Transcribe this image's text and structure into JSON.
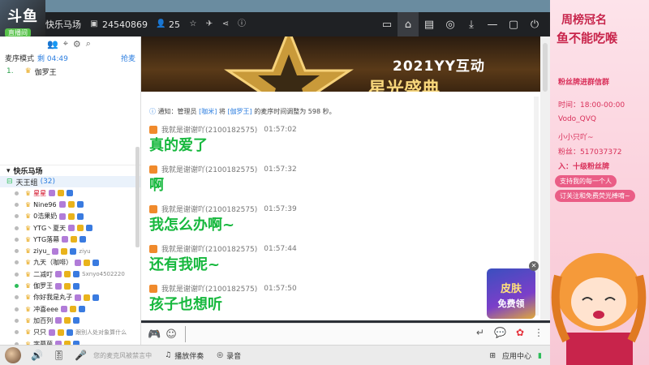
{
  "window": {
    "channel_name": "快乐马场",
    "channel_id": "24540869",
    "user_count": "25",
    "logo_text": "斗鱼",
    "level_badge": "直播间"
  },
  "queue": {
    "mode_label": "麦序模式",
    "remaining_label": "剩 04:49",
    "grab_label": "抢麦",
    "items": [
      {
        "num": "1.",
        "name": "伽罗王"
      }
    ]
  },
  "members": {
    "channel": "快乐马场",
    "group_name": "天王组",
    "group_count": "(32)",
    "list": [
      {
        "name": "星星",
        "online": false,
        "red": true
      },
      {
        "name": "Nine96",
        "online": false
      },
      {
        "name": "0浩果奶",
        "online": false
      },
      {
        "name": "YTG丶夏天",
        "online": false
      },
      {
        "name": "YTG落幕",
        "online": false
      },
      {
        "name": "ziyu_",
        "online": false,
        "tag": "ziyu"
      },
      {
        "name": "九天（咖啡）",
        "online": false
      },
      {
        "name": "二减叮",
        "online": false,
        "tag": "Sxnyo4502220"
      },
      {
        "name": "伽罗王",
        "online": true
      },
      {
        "name": "你好我是丸子",
        "online": false
      },
      {
        "name": "冲喜eee",
        "online": false
      },
      {
        "name": "加百列",
        "online": false
      },
      {
        "name": "只只",
        "online": false,
        "tag": "跟别人处对象算什么"
      },
      {
        "name": "字幕菌",
        "online": false
      },
      {
        "name": "小乐爱片",
        "online": false,
        "tag": "我好饱"
      }
    ]
  },
  "banner": {
    "title": "2021YY互动",
    "subtitle": "星光盛典"
  },
  "chat": {
    "notice_prefix": "通知：管理员",
    "notice_admin": "[咖米]",
    "notice_mid": "将",
    "notice_target": "[伽罗王]",
    "notice_suffix": "的麦序时间调整为 598 秒。",
    "messages": [
      {
        "user": "我就是谢谢吖(2100182575)",
        "time": "01:57:02",
        "text": "真的爱了"
      },
      {
        "user": "我就是谢谢吖(2100182575)",
        "time": "01:57:32",
        "text": "啊"
      },
      {
        "user": "我就是谢谢吖(2100182575)",
        "time": "01:57:39",
        "text": "我怎么办啊~"
      },
      {
        "user": "我就是谢谢吖(2100182575)",
        "time": "01:57:44",
        "text": "还有我呢~"
      },
      {
        "user": "我就是谢谢吖(2100182575)",
        "time": "01:57:50",
        "text": "孩子也想听"
      }
    ],
    "ad_line1": "皮肤",
    "ad_line2": "免费领"
  },
  "input": {
    "placeholder": ""
  },
  "bottom": {
    "mic_tip": "您的麦克风被禁言中",
    "accompany_label": "播放伴奏",
    "record_label": "录音",
    "app_center_label": "应用中心"
  },
  "overlay": {
    "title1": "周榜冠名",
    "title2": "鱼不能吃喉",
    "line1": "粉丝牌进群信群",
    "line2": "时间：18:00-00:00",
    "line3": "Vodo_QVQ",
    "line4": "小小只吖~",
    "line5": "粉丝：517037372",
    "line6": "入：十级粉丝牌",
    "pill1": "支持我的每一个人",
    "pill2": "订关注和免费荧光棒唷~"
  },
  "colors": {
    "chat_green": "#17b83e",
    "link_blue": "#2e7fe0",
    "titlebar": "#1f2124",
    "overlay_red": "#c8244b"
  }
}
